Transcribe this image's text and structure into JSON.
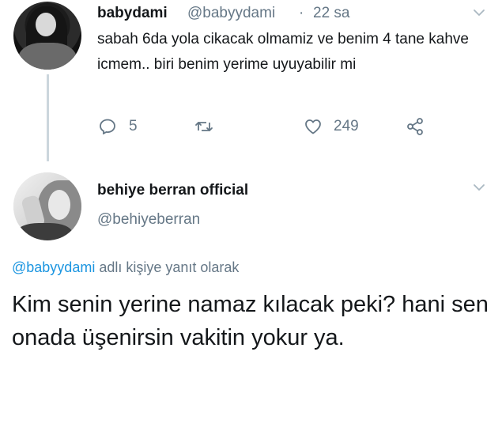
{
  "tweet1": {
    "display_name": "babydami",
    "handle": "@babyydami",
    "separator": "·",
    "time": "22 sa",
    "text": "sabah 6da yola cikacak olmamiz ve benim 4 tane kahve icmem.. biri benim yerime uyuyabilir mi",
    "reply_count": "5",
    "like_count": "249"
  },
  "tweet2": {
    "display_name": "behiye berran official",
    "handle": "@behiyeberran",
    "reply_mention": "@babyydami",
    "reply_suffix": " adlı kişiye yanıt olarak",
    "text": "Kim senin yerine namaz kılacak peki? hani sen onada üşenirsin vakitin yokur ya."
  },
  "icons": [
    "chevron-down-icon",
    "reply-icon",
    "retweet-icon",
    "like-icon",
    "share-icon"
  ],
  "colors": {
    "text": "#14171a",
    "secondary": "#657786",
    "link": "#1b95e0",
    "thread_line": "#ccd6dd"
  }
}
